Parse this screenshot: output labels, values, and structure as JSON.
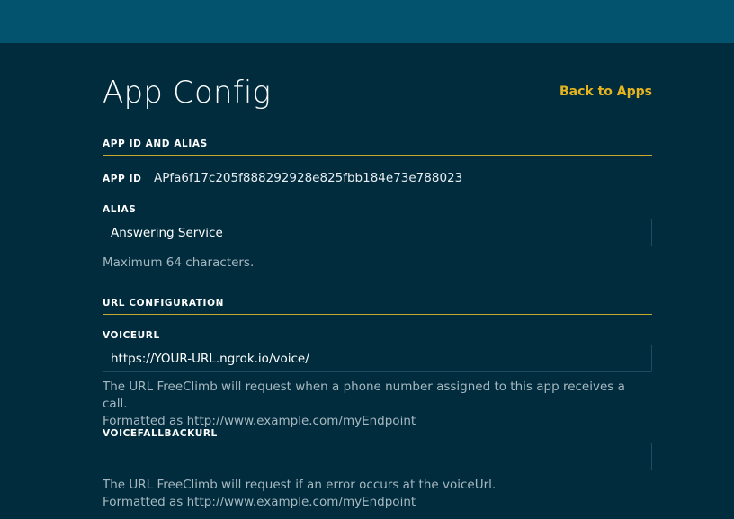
{
  "page": {
    "title": "App Config",
    "back_link": "Back to Apps"
  },
  "app_id_section": {
    "header": "APP ID AND ALIAS",
    "app_id_label": "APP ID",
    "app_id_value": "APfa6f17c205f888292928e825fbb184e73e788023",
    "alias_label": "ALIAS",
    "alias_value": "Answering Service",
    "alias_help": "Maximum 64 characters."
  },
  "url_section": {
    "header": "URL CONFIGURATION",
    "voice_url_label": "VOICEURL",
    "voice_url_value": "https://YOUR-URL.ngrok.io/voice/",
    "voice_url_help_1": "The URL FreeClimb will request when a phone number assigned to this app receives a call.",
    "voice_url_help_2": "Formatted as http://www.example.com/myEndpoint",
    "voice_fallback_label": "VOICEFALLBACKURL",
    "voice_fallback_value": "",
    "voice_fallback_help_1": "The URL FreeClimb will request if an error occurs at the voiceUrl.",
    "voice_fallback_help_2": "Formatted as http://www.example.com/myEndpoint"
  },
  "colors": {
    "background": "#002c3d",
    "topbar": "#03536e",
    "accent": "#e6b41e",
    "divider": "#c9a82a"
  }
}
